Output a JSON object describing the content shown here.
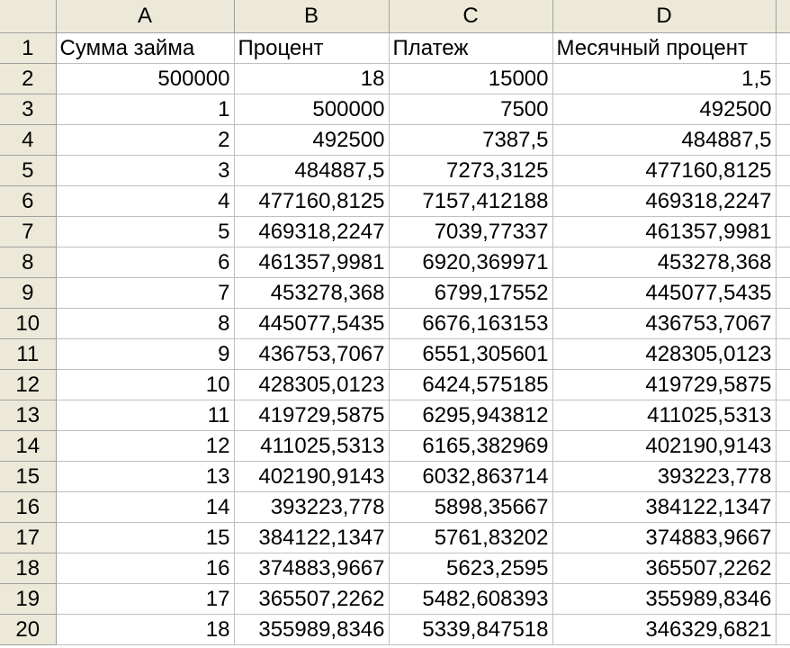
{
  "columns": [
    "A",
    "B",
    "C",
    "D"
  ],
  "rows": [
    {
      "num": "1",
      "a": "Сумма займа",
      "b": "Процент",
      "c": "Платеж",
      "d": "Месячный процент"
    },
    {
      "num": "2",
      "a": "500000",
      "b": "18",
      "c": "15000",
      "d": "1,5"
    },
    {
      "num": "3",
      "a": "1",
      "b": "500000",
      "c": "7500",
      "d": "492500"
    },
    {
      "num": "4",
      "a": "2",
      "b": "492500",
      "c": "7387,5",
      "d": "484887,5"
    },
    {
      "num": "5",
      "a": "3",
      "b": "484887,5",
      "c": "7273,3125",
      "d": "477160,8125"
    },
    {
      "num": "6",
      "a": "4",
      "b": "477160,8125",
      "c": "7157,412188",
      "d": "469318,2247"
    },
    {
      "num": "7",
      "a": "5",
      "b": "469318,2247",
      "c": "7039,77337",
      "d": "461357,9981"
    },
    {
      "num": "8",
      "a": "6",
      "b": "461357,9981",
      "c": "6920,369971",
      "d": "453278,368"
    },
    {
      "num": "9",
      "a": "7",
      "b": "453278,368",
      "c": "6799,17552",
      "d": "445077,5435"
    },
    {
      "num": "10",
      "a": "8",
      "b": "445077,5435",
      "c": "6676,163153",
      "d": "436753,7067"
    },
    {
      "num": "11",
      "a": "9",
      "b": "436753,7067",
      "c": "6551,305601",
      "d": "428305,0123"
    },
    {
      "num": "12",
      "a": "10",
      "b": "428305,0123",
      "c": "6424,575185",
      "d": "419729,5875"
    },
    {
      "num": "13",
      "a": "11",
      "b": "419729,5875",
      "c": "6295,943812",
      "d": "411025,5313"
    },
    {
      "num": "14",
      "a": "12",
      "b": "411025,5313",
      "c": "6165,382969",
      "d": "402190,9143"
    },
    {
      "num": "15",
      "a": "13",
      "b": "402190,9143",
      "c": "6032,863714",
      "d": "393223,778"
    },
    {
      "num": "16",
      "a": "14",
      "b": "393223,778",
      "c": "5898,35667",
      "d": "384122,1347"
    },
    {
      "num": "17",
      "a": "15",
      "b": "384122,1347",
      "c": "5761,83202",
      "d": "374883,9667"
    },
    {
      "num": "18",
      "a": "16",
      "b": "374883,9667",
      "c": "5623,2595",
      "d": "365507,2262"
    },
    {
      "num": "19",
      "a": "17",
      "b": "365507,2262",
      "c": "5482,608393",
      "d": "355989,8346"
    },
    {
      "num": "20",
      "a": "18",
      "b": "355989,8346",
      "c": "5339,847518",
      "d": "346329,6821"
    }
  ]
}
